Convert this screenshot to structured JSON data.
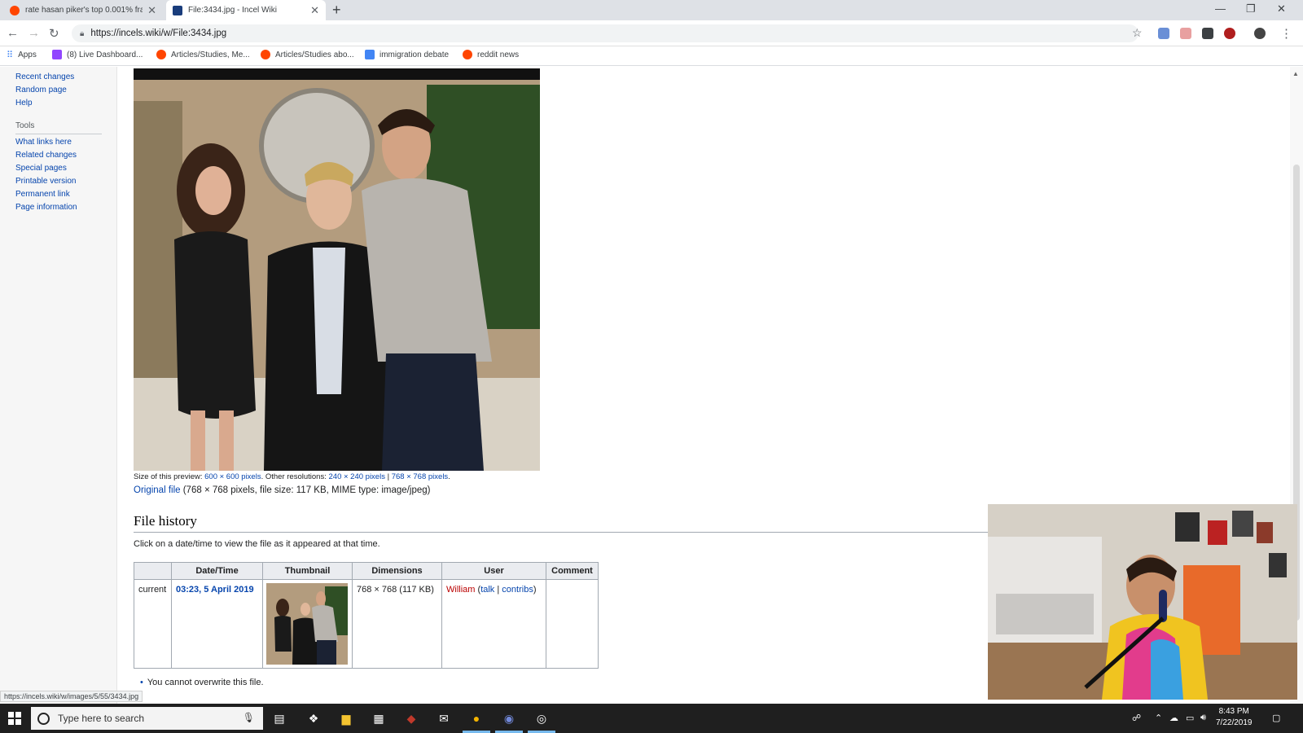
{
  "browser": {
    "tabs": [
      {
        "title": "rate hasan piker's top 0.001% fra",
        "active": false
      },
      {
        "title": "File:3434.jpg - Incel Wiki",
        "active": true
      }
    ],
    "url": "https://incels.wiki/w/File:3434.jpg",
    "bookmarks": [
      "Apps",
      "(8) Live Dashboard...",
      "Articles/Studies, Me...",
      "Articles/Studies abo...",
      "immigration debate",
      "reddit news"
    ],
    "status_url": "https://incels.wiki/w/images/5/55/3434.jpg"
  },
  "sidebar": {
    "nav_links": [
      "Recent changes",
      "Random page",
      "Help"
    ],
    "tools_heading": "Tools",
    "tools_links": [
      "What links here",
      "Related changes",
      "Special pages",
      "Printable version",
      "Permanent link",
      "Page information"
    ]
  },
  "file": {
    "preview_prefix": "Size of this preview:",
    "preview_size": "600 × 600 pixels",
    "other_res_prefix": ". Other resolutions:",
    "res_1": "240 × 240 pixels",
    "sep": " | ",
    "res_2": "768 × 768 pixels",
    "res_suffix": ".",
    "original_link": "Original file",
    "original_info": " (768 × 768 pixels, file size: 117 KB, MIME type: image/jpeg)"
  },
  "history": {
    "title": "File history",
    "intro": "Click on a date/time to view the file as it appeared at that time.",
    "columns": [
      "",
      "Date/Time",
      "Thumbnail",
      "Dimensions",
      "User",
      "Comment"
    ],
    "row": {
      "status": "current",
      "datetime": "03:23, 5 April 2019",
      "dimensions": "768 × 768 (117 KB)",
      "user": "William",
      "talk": "talk",
      "contribs": "contribs",
      "comment": ""
    },
    "note": "You cannot overwrite this file."
  },
  "taskbar": {
    "search_placeholder": "Type here to search",
    "time": "8:43 PM",
    "date": "7/22/2019"
  }
}
